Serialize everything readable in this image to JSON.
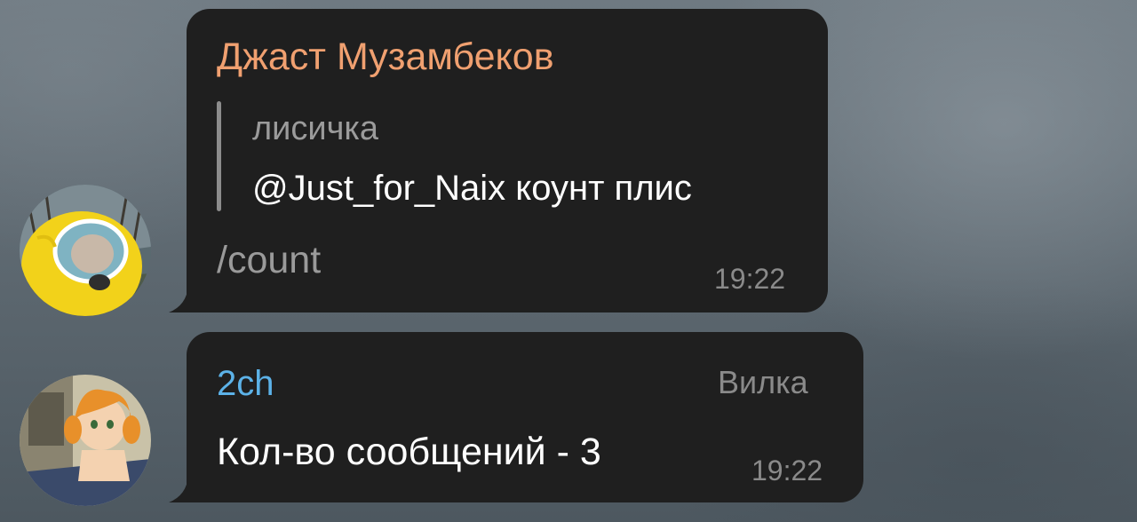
{
  "messages": [
    {
      "sender": "Джаст Музамбеков",
      "sender_color": "#f0a070",
      "reply": {
        "author": "лисичка",
        "text": "@Just_for_Naix коунт плис"
      },
      "text": "/count",
      "text_color": "#9a9a9a",
      "time": "19:22"
    },
    {
      "sender": "2ch",
      "sender_color": "#5cb2e8",
      "title": "Вилка",
      "text": "Кол-во сообщений - 3",
      "text_color": "#ffffff",
      "time": "19:22"
    }
  ],
  "colors": {
    "bubble": "#1f1f1f",
    "reply_bar": "#8c8c8c",
    "timestamp": "#8a8a8a"
  }
}
